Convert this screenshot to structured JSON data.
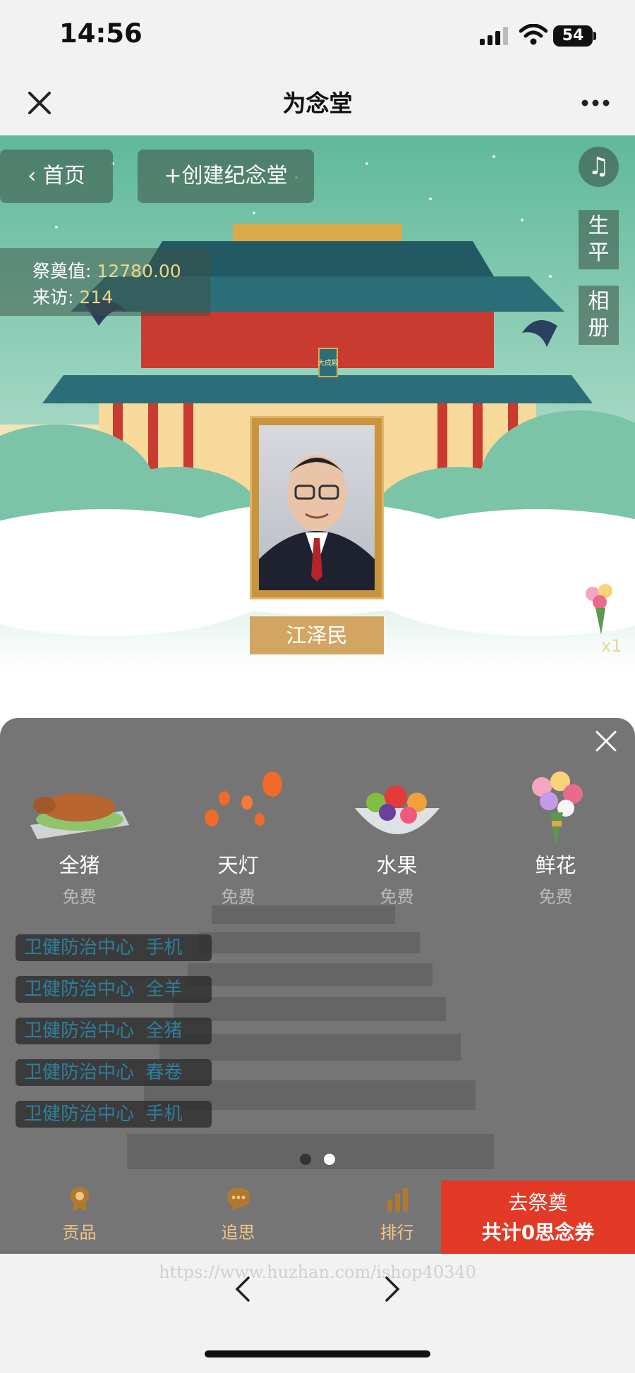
{
  "status_bar": {
    "time": "14:56",
    "battery": "54"
  },
  "nav": {
    "title": "为念堂"
  },
  "hall": {
    "home_button": "首页",
    "create_button": "创建纪念堂",
    "side_tabs": [
      "生平",
      "相册"
    ],
    "stats": {
      "offering_label": "祭奠值:",
      "offering_value": "12780.00",
      "visits_label": "来访:",
      "visits_value": "214"
    },
    "name": "江泽民",
    "plaque_text": "大成殿",
    "flower_count": "x1"
  },
  "gifts": [
    {
      "label": "全猪",
      "price": "免费",
      "icon": "roast-pig-icon"
    },
    {
      "label": "天灯",
      "price": "免费",
      "icon": "sky-lantern-icon"
    },
    {
      "label": "水果",
      "price": "免费",
      "icon": "fruit-bowl-icon"
    },
    {
      "label": "鲜花",
      "price": "免费",
      "icon": "bouquet-icon"
    }
  ],
  "ticker": [
    {
      "from": "卫健防治中心",
      "item": "手机"
    },
    {
      "from": "卫健防治中心",
      "item": "全羊"
    },
    {
      "from": "卫健防治中心",
      "item": "全猪"
    },
    {
      "from": "卫健防治中心",
      "item": "春卷"
    },
    {
      "from": "卫健防治中心",
      "item": "手机"
    }
  ],
  "pager": {
    "active_index": 1,
    "count": 2
  },
  "bottom_tabs": [
    {
      "label": "贡品",
      "icon": "award-icon"
    },
    {
      "label": "追思",
      "icon": "chat-bubble-icon"
    },
    {
      "label": "排行",
      "icon": "bar-chart-icon"
    }
  ],
  "cta": {
    "line1": "去祭奠",
    "line2": "共计0思念券"
  },
  "browser": {
    "url": "https://www.huzhan.com/ishop40340"
  },
  "colors": {
    "cta": "#e23a27",
    "tab_text": "#f0c48a",
    "plate": "#d2a662"
  }
}
